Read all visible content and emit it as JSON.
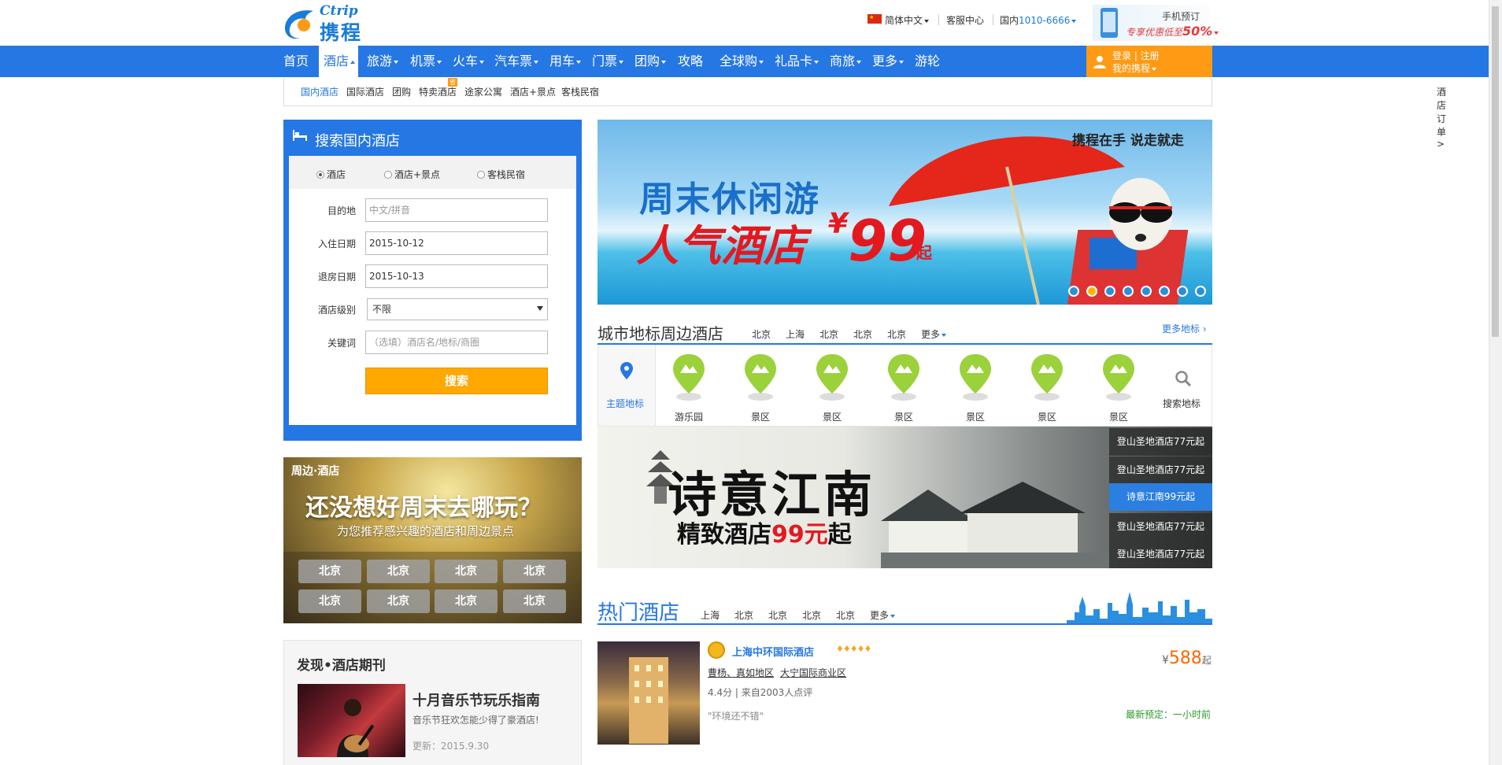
{
  "header": {
    "logo_en": "Ctrip",
    "logo_cn": "携程",
    "language": "简体中文",
    "service": "客服中心",
    "domestic_label": "国内",
    "phone": "1010-6666",
    "mobile_title": "手机预订",
    "mobile_promo_prefix": "专享优惠低至",
    "mobile_promo_value": "50%"
  },
  "nav": {
    "items": [
      {
        "label": "首页",
        "caret": false
      },
      {
        "label": "酒店",
        "caret": true,
        "active": true
      },
      {
        "label": "旅游",
        "caret": true
      },
      {
        "label": "机票",
        "caret": true
      },
      {
        "label": "火车",
        "caret": true
      },
      {
        "label": "汽车票",
        "caret": true
      },
      {
        "label": "用车",
        "caret": true
      },
      {
        "label": "门票",
        "caret": true
      },
      {
        "label": "团购",
        "caret": true
      },
      {
        "label": "攻略",
        "caret": false
      },
      {
        "label": "全球购",
        "caret": true
      },
      {
        "label": "礼品卡",
        "caret": true
      },
      {
        "label": "商旅",
        "caret": true
      },
      {
        "label": "更多",
        "caret": true
      },
      {
        "label": "游轮",
        "caret": false
      }
    ],
    "login_line1": "登录 | 注册",
    "login_line2": "我的携程"
  },
  "subnav": {
    "items": [
      "国内酒店",
      "国际酒店",
      "团购",
      "特卖酒店",
      "途家公寓",
      "酒店+景点",
      "客栈民宿"
    ],
    "badge": "省",
    "orders": "酒店订单>"
  },
  "search": {
    "title": "搜索国内酒店",
    "radios": [
      "酒店",
      "酒店+景点",
      "客栈民宿"
    ],
    "destination_label": "目的地",
    "destination_placeholder": "中文/拼音",
    "checkin_label": "入住日期",
    "checkin_value": "2015-10-12",
    "checkout_label": "退房日期",
    "checkout_value": "2015-10-13",
    "level_label": "酒店级别",
    "level_value": "不限",
    "keyword_label": "关键词",
    "keyword_placeholder": "（选填）酒店名/地标/商圈",
    "button": "搜索"
  },
  "promo": {
    "tag": "周边·酒店",
    "title": "还没想好周末去哪玩？",
    "subtitle": "为您推荐感兴趣的酒店和周边景点",
    "cities": [
      "北京",
      "北京",
      "北京",
      "北京",
      "北京",
      "北京",
      "北京",
      "北京"
    ]
  },
  "journal": {
    "title": "发现•酒店期刊",
    "headline": "十月音乐节玩乐指南",
    "desc": "音乐节狂欢怎能少得了豪酒店!",
    "date": "更新：2015.9.30"
  },
  "banner": {
    "line1": "周末休闲游",
    "line2": "人气酒店",
    "currency": "¥",
    "price": "99",
    "suffix": "起",
    "slogan": "携程在手  说走就走",
    "dot_count": 8,
    "active_dot": 1
  },
  "landmarks": {
    "title": "城市地标周边酒店",
    "tabs": [
      "北京",
      "上海",
      "北京",
      "北京",
      "北京",
      "更多"
    ],
    "more": "更多地标",
    "theme_label": "主题地标",
    "pins": [
      "游乐园",
      "景区",
      "景区",
      "景区",
      "景区",
      "景区",
      "景区"
    ],
    "search_label": "搜索地标"
  },
  "jiangnan": {
    "calligraphy": "诗意江南",
    "sub_prefix": "精致酒店",
    "sub_price": "99元",
    "sub_suffix": "起",
    "items": [
      "登山圣地酒店77元起",
      "登山圣地酒店77元起",
      "诗意江南99元起",
      "登山圣地酒店77元起",
      "登山圣地酒店77元起"
    ],
    "active_index": 2
  },
  "hot": {
    "title": "热门酒店",
    "tabs": [
      "上海",
      "北京",
      "北京",
      "北京",
      "北京",
      "更多"
    ],
    "hotel": {
      "name": "上海中环国际酒店",
      "stars": "♦♦♦♦♦",
      "district1": "曹杨、真如地区",
      "district2": "大宁国际商业区",
      "score": "4.4分",
      "reviews": "来自2003人点评",
      "quote": "\"环境还不错\"",
      "currency": "¥",
      "price": "588",
      "price_suffix": "起",
      "latest": "最新预定：一小时前"
    }
  },
  "colors": {
    "brand_blue": "#2577e3",
    "orange": "#ff9a14",
    "red": "#e4191f"
  }
}
